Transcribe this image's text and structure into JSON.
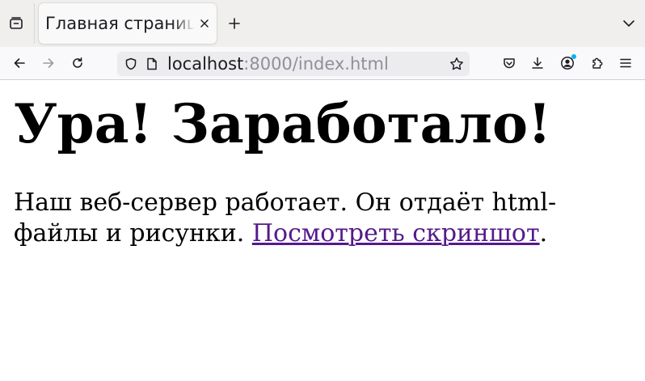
{
  "browser": {
    "tab": {
      "title": "Главная страница",
      "active": true
    },
    "address_bar": {
      "host": "localhost",
      "rest": ":8000/index.html"
    },
    "icons": {
      "tab_overview": "firefox-view-icon",
      "tab_close": "close-icon",
      "new_tab": "plus-icon",
      "tab_list": "chevron-down-icon",
      "back": "back-arrow-icon",
      "forward": "forward-arrow-icon",
      "reload": "reload-icon",
      "tracking_protection": "shield-icon",
      "page_info": "page-icon",
      "bookmark": "star-icon",
      "pocket": "pocket-icon",
      "downloads": "download-icon",
      "account": "account-icon",
      "extensions": "puzzle-icon",
      "menu": "hamburger-menu-icon"
    },
    "accent_color": "#00b3f4"
  },
  "page": {
    "heading": "Ура! Заработало!",
    "paragraph_start": "Наш веб-сервер работает. Он отдаёт html-файлы и рисунки. ",
    "link_text": "Посмотреть скриншот",
    "paragraph_end": ".",
    "link_color": "#551a8b"
  }
}
